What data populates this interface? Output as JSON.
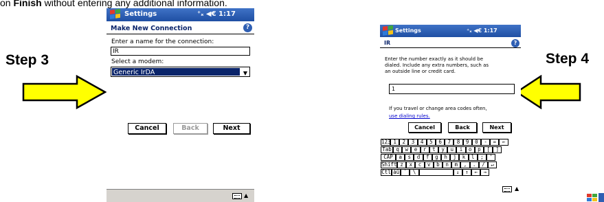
{
  "intro": {
    "prefix": "on ",
    "bold": "Finish",
    "suffix": " without entering any additional information."
  },
  "step3": {
    "label": "Step 3"
  },
  "step4": {
    "label": "Step 4"
  },
  "left_device": {
    "title": "Settings",
    "status": "⁺ˣ ◀€ 1:17",
    "clock": "1:17",
    "heading": "Make New Connection",
    "name_label": "Enter a name for the connection:",
    "name_value": "IR",
    "modem_label": "Select a modem:",
    "modem_value": "Generic IrDA",
    "buttons": {
      "cancel": "Cancel",
      "back": "Back",
      "next": "Next"
    }
  },
  "right_device": {
    "title": "Settings",
    "clock": "1:17",
    "heading": "IR",
    "instructions": [
      "Enter the number exactly as it should be",
      "dialed.  Include any extra numbers, such as",
      "an outside line or credit card."
    ],
    "number_value": "1",
    "travel_text": "If you travel or change area codes often,",
    "link_text": "use dialing rules.",
    "buttons": {
      "cancel": "Cancel",
      "back": "Back",
      "next": "Next"
    },
    "keyboard": [
      [
        "123",
        "1",
        "2",
        "3",
        "4",
        "5",
        "6",
        "7",
        "8",
        "9",
        "0",
        "-",
        "=",
        "←"
      ],
      [
        "Tab",
        "q",
        "w",
        "e",
        "r",
        "t",
        "y",
        "u",
        "i",
        "o",
        "p",
        "[",
        "]"
      ],
      [
        "CAP",
        "a",
        "s",
        "d",
        "f",
        "g",
        "h",
        "j",
        "k",
        "l",
        ";",
        "'"
      ],
      [
        "Shift",
        "z",
        "x",
        "c",
        "v",
        "b",
        "n",
        "m",
        ",",
        ".",
        "/",
        "↵"
      ],
      [
        "Ctl",
        "áü",
        "`",
        "\\",
        "",
        "↓",
        "↑",
        "←",
        "→"
      ]
    ]
  },
  "colors": {
    "title_bar": "#2a5cb0",
    "arrow_fill": "#ffff00",
    "selection": "#0a246a"
  }
}
